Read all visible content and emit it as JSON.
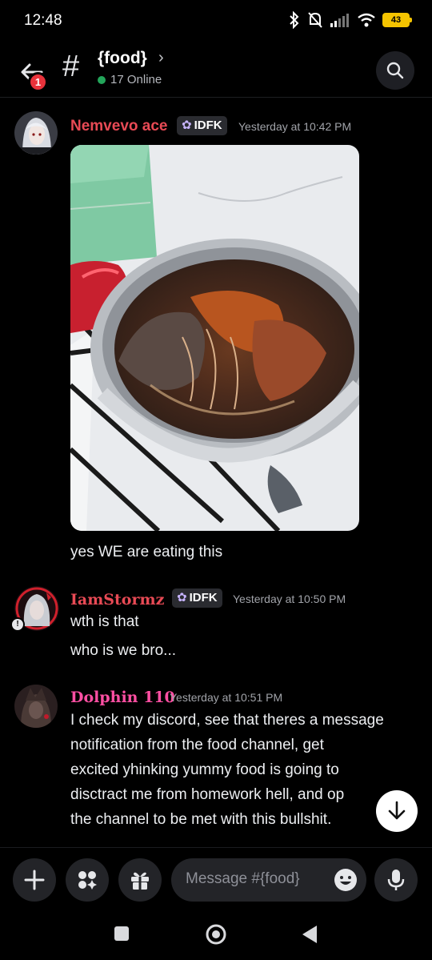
{
  "status_bar": {
    "time": "12:48",
    "battery": "43"
  },
  "header": {
    "notification_count": "1",
    "channel_name": "{food}",
    "online": "17 Online"
  },
  "messages": [
    {
      "author": "Nemvevo ace",
      "author_color": "#e84a55",
      "tag": "IDFK",
      "timestamp": "Yesterday at 10:42 PM",
      "lines": [
        "yes WE are eating this"
      ]
    },
    {
      "author": "IamStormz",
      "author_color": "#e84a55",
      "tag": "IDFK",
      "timestamp": "Yesterday at 10:50 PM",
      "lines": [
        "wth is that",
        "who is we bro..."
      ]
    },
    {
      "author": "Dolphin 110",
      "author_color": "#ff4fa3",
      "timestamp": "Yesterday at 10:51 PM",
      "lines": [
        "I check my discord, see that theres a message",
        "notification from the food channel, get",
        "excited yhinking yummy food is going to",
        "disctract me from homework hell, and op",
        "the channel to be met with this bullshit."
      ]
    }
  ],
  "composer": {
    "placeholder": "Message #{food}"
  },
  "icons": [
    "back-arrow-icon",
    "hash-icon",
    "search-icon",
    "plus-icon",
    "apps-icon",
    "gift-icon",
    "emoji-icon",
    "microphone-icon",
    "arrow-down-icon",
    "recent-apps-icon",
    "home-icon",
    "back-icon"
  ]
}
